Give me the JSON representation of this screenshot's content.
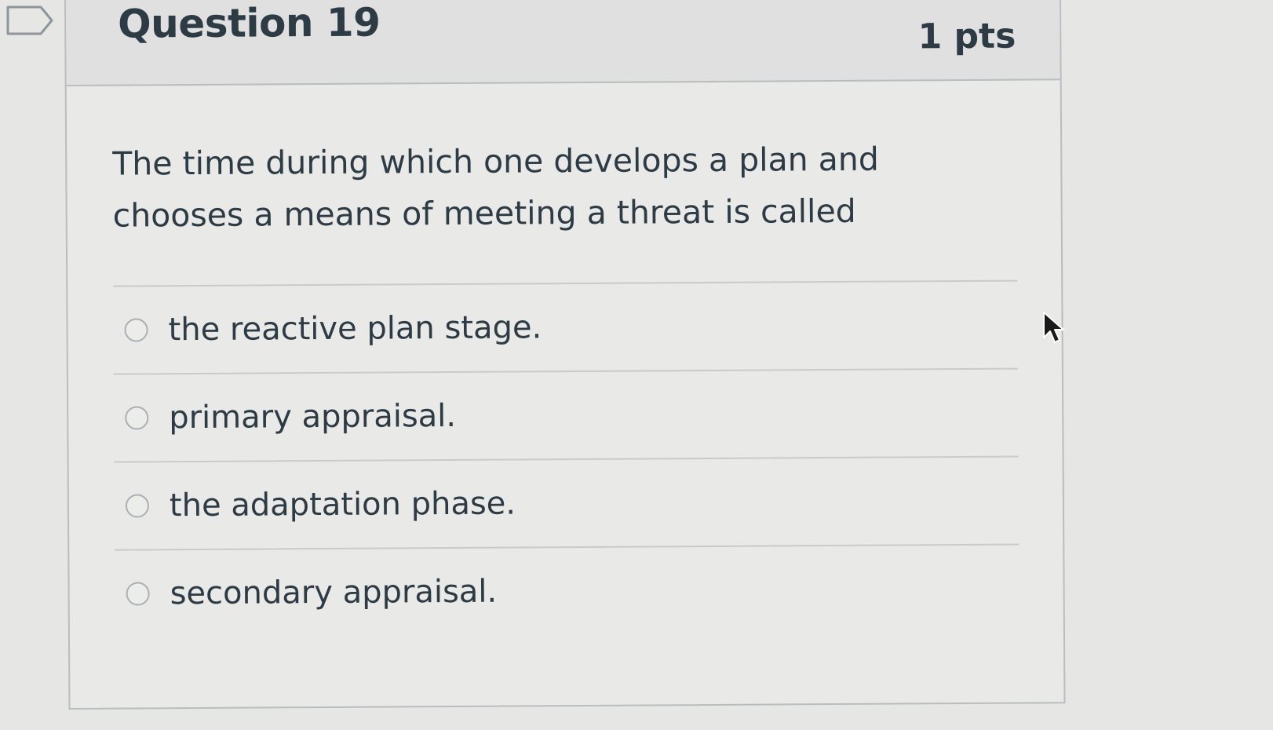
{
  "question": {
    "title": "Question 19",
    "points": "1 pts",
    "text": "The time during which one develops a plan and chooses a means of meeting a threat is called",
    "answers": [
      {
        "label": "the reactive plan stage.",
        "selected": false
      },
      {
        "label": "primary appraisal.",
        "selected": false
      },
      {
        "label": "the adaptation phase.",
        "selected": false
      },
      {
        "label": "secondary appraisal.",
        "selected": false
      }
    ]
  },
  "icons": {
    "flag": "flag-icon",
    "radio": "radio-button",
    "cursor": "mouse-pointer-icon"
  },
  "colors": {
    "text": "#2d3b45",
    "header_bg": "#dfe0df",
    "border": "#b9bdbf"
  }
}
